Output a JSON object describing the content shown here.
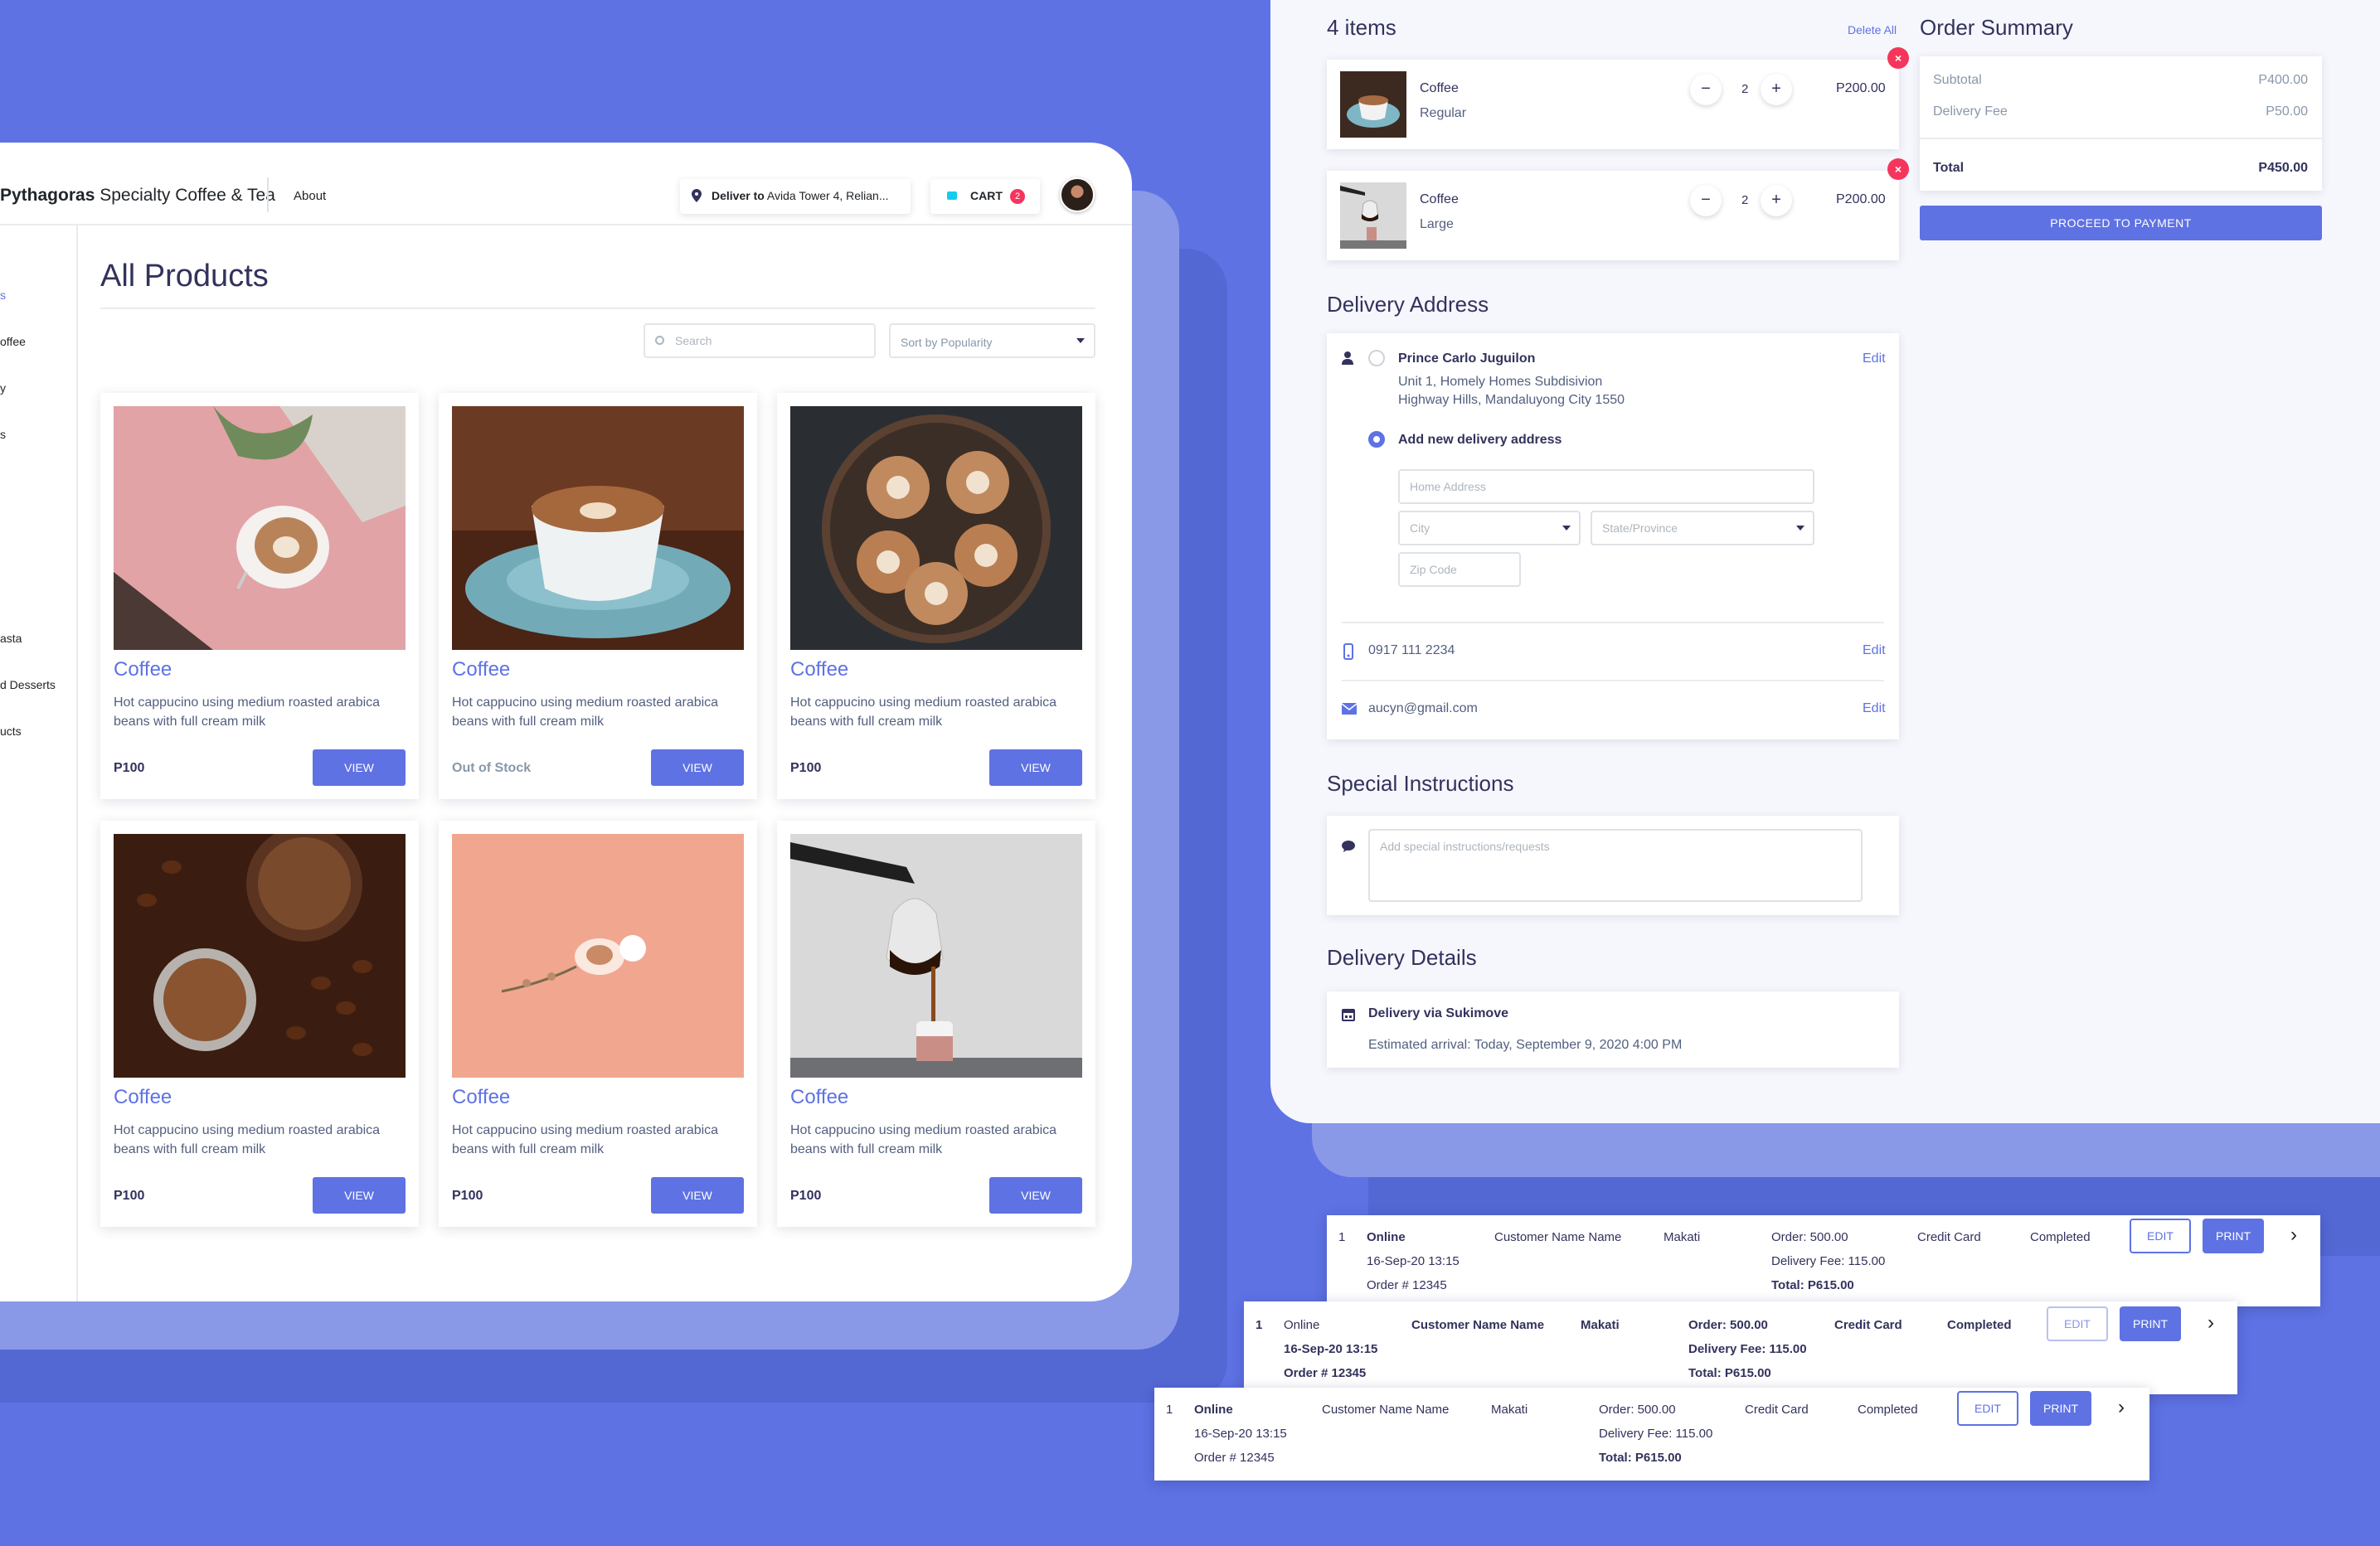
{
  "colors": {
    "background": "#5e72e4",
    "accent": "#5e72e4",
    "danger": "#f5365c",
    "info": "#11cdef"
  },
  "products_page": {
    "brand_bold": "Pythagoras",
    "brand_rest": " Specialty Coffee & Tea",
    "nav_about": "About",
    "deliver_label": "Deliver to",
    "deliver_address": " Avida Tower 4, Relian...",
    "cart_label": "CART",
    "cart_count": "2",
    "sidebar_items": [
      "s",
      "offee",
      "y",
      "s",
      "asta",
      "d Desserts",
      "ucts"
    ],
    "title": "All Products",
    "search_placeholder": "Search",
    "sort_label": "Sort by Popularity",
    "products": [
      {
        "name": "Coffee",
        "desc": "Hot cappucino using medium roasted arabica beans with full cream milk",
        "price": "P100",
        "button": "VIEW"
      },
      {
        "name": "Coffee",
        "desc": "Hot cappucino using medium roasted arabica beans with full cream milk",
        "price": "Out of Stock",
        "button": "VIEW"
      },
      {
        "name": "Coffee",
        "desc": "Hot cappucino using medium roasted arabica beans with full cream milk",
        "price": "P100",
        "button": "VIEW"
      },
      {
        "name": "Coffee",
        "desc": "Hot cappucino using medium roasted arabica beans with full cream milk",
        "price": "P100",
        "button": "VIEW"
      },
      {
        "name": "Coffee",
        "desc": "Hot cappucino using medium roasted arabica beans with full cream milk",
        "price": "P100",
        "button": "VIEW"
      },
      {
        "name": "Coffee",
        "desc": "Hot cappucino using medium roasted arabica beans with full cream milk",
        "price": "P100",
        "button": "VIEW"
      }
    ]
  },
  "checkout": {
    "items_heading": "4 items",
    "delete_all": "Delete All",
    "cart_items": [
      {
        "name": "Coffee",
        "size": "Regular",
        "qty": "2",
        "price": "P200.00",
        "minus": "−",
        "plus": "+",
        "remove": "×"
      },
      {
        "name": "Coffee",
        "size": "Large",
        "qty": "2",
        "price": "P200.00",
        "minus": "−",
        "plus": "+",
        "remove": "×"
      }
    ],
    "summary": {
      "heading": "Order Summary",
      "subtotal_label": "Subtotal",
      "subtotal": "P400.00",
      "fee_label": "Delivery Fee",
      "fee": "P50.00",
      "total_label": "Total",
      "total": "P450.00",
      "proceed": "PROCEED TO PAYMENT"
    },
    "address": {
      "heading": "Delivery Address",
      "name": "Prince Carlo Juguilon",
      "line1": "Unit 1, Homely Homes Subdisivion",
      "line2": "Highway Hills, Mandaluyong City 1550",
      "edit": "Edit",
      "add_new": "Add new delivery address",
      "home_placeholder": "Home Address",
      "city_placeholder": "City",
      "state_placeholder": "State/Province",
      "zip_placeholder": "Zip Code",
      "phone": "0917 111 2234",
      "email": "aucyn@gmail.com"
    },
    "instructions": {
      "heading": "Special Instructions",
      "placeholder": "Add special instructions/requests"
    },
    "delivery": {
      "heading": "Delivery Details",
      "method": "Delivery via Sukimove",
      "eta": "Estimated arrival: Today, September 9, 2020 4:00 PM"
    }
  },
  "orders": [
    {
      "no": "1",
      "type": "Online",
      "date": "16-Sep-20 13:15",
      "order_id": "Order # 12345",
      "customer": "Customer Name Name",
      "city": "Makati",
      "order": "Order: 500.00",
      "fee": "Delivery Fee: 115.00",
      "total": "Total: P615.00",
      "payment": "Credit Card",
      "status": "Completed",
      "edit": "EDIT",
      "print": "PRINT"
    },
    {
      "no": "1",
      "type": "Online",
      "date": "16-Sep-20 13:15",
      "order_id": "Order # 12345",
      "customer": "Customer Name Name",
      "city": "Makati",
      "order": "Order: 500.00",
      "fee": "Delivery Fee: 115.00",
      "total": "Total: P615.00",
      "payment": "Credit Card",
      "status": "Completed",
      "edit": "EDIT",
      "print": "PRINT"
    },
    {
      "no": "1",
      "type": "Online",
      "date": "16-Sep-20 13:15",
      "order_id": "Order # 12345",
      "customer": "Customer Name Name",
      "city": "Makati",
      "order": "Order: 500.00",
      "fee": "Delivery Fee: 115.00",
      "total": "Total: P615.00",
      "payment": "Credit Card",
      "status": "Completed",
      "edit": "EDIT",
      "print": "PRINT"
    }
  ]
}
